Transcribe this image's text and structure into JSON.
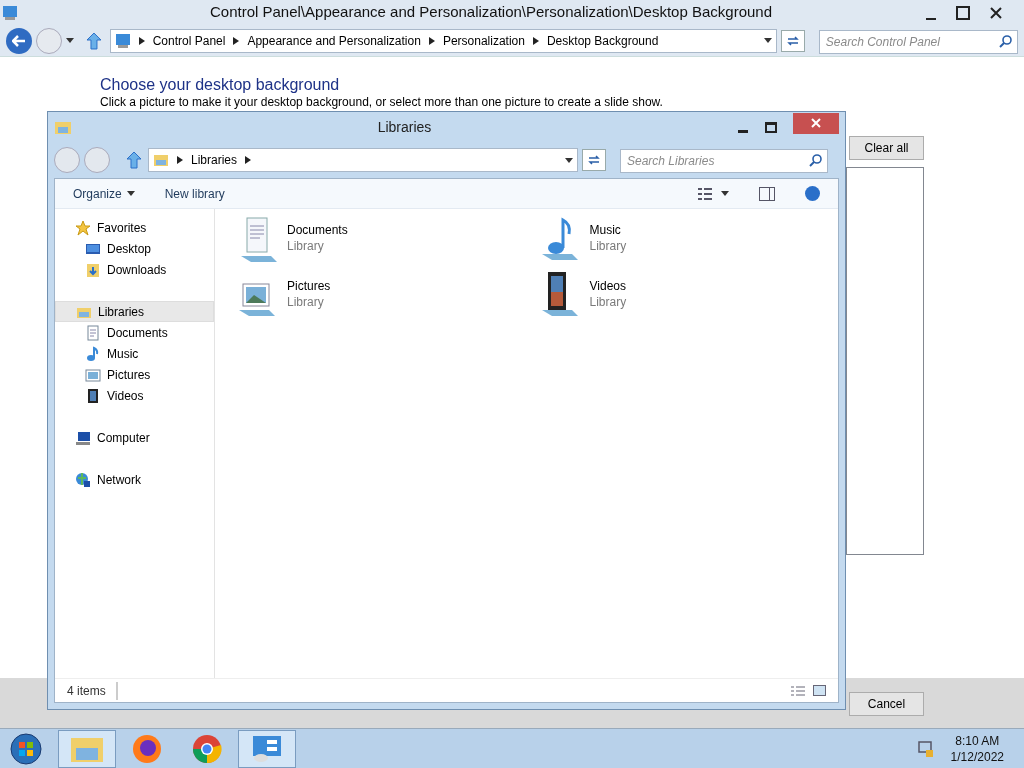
{
  "cp_window": {
    "title": "Control Panel\\Appearance and Personalization\\Personalization\\Desktop Background",
    "breadcrumb": [
      "Control Panel",
      "Appearance and Personalization",
      "Personalization",
      "Desktop Background"
    ],
    "search": {
      "placeholder": "Search Control Panel"
    },
    "heading": "Choose your desktop background",
    "description": "Click a picture to make it your desktop background, or select more than one picture to create a slide show.",
    "buttons": [
      {
        "label": "Clear all"
      },
      {
        "label": "Cancel"
      }
    ]
  },
  "libraries_window": {
    "title": "Libraries",
    "breadcrumb": [
      "Libraries"
    ],
    "search": {
      "placeholder": "Search Libraries"
    },
    "toolbar": [
      {
        "label": "Organize",
        "dropdown": true
      },
      {
        "label": "New library",
        "dropdown": false
      }
    ],
    "nav": [
      {
        "label": "Favorites",
        "kind": "star",
        "selected": false,
        "children": [
          {
            "label": "Desktop",
            "kind": "desktop",
            "selected": false
          },
          {
            "label": "Downloads",
            "kind": "downloads",
            "selected": false
          }
        ]
      },
      {
        "label": "Libraries",
        "kind": "libraries",
        "selected": true,
        "children": [
          {
            "label": "Documents",
            "kind": "documents",
            "selected": false
          },
          {
            "label": "Music",
            "kind": "music",
            "selected": false
          },
          {
            "label": "Pictures",
            "kind": "pictures",
            "selected": false
          },
          {
            "label": "Videos",
            "kind": "videos",
            "selected": false
          }
        ]
      },
      {
        "label": "Computer",
        "kind": "computer",
        "selected": false
      },
      {
        "label": "Network",
        "kind": "network",
        "selected": false
      }
    ],
    "items": [
      {
        "name": "Documents",
        "type": "Library",
        "kind": "documents"
      },
      {
        "name": "Music",
        "type": "Library",
        "kind": "music"
      },
      {
        "name": "Pictures",
        "type": "Library",
        "kind": "pictures"
      },
      {
        "name": "Videos",
        "type": "Library",
        "kind": "videos"
      }
    ],
    "status": "4 items"
  },
  "taskbar": {
    "apps": [
      {
        "kind": "explorer",
        "selected": true
      },
      {
        "kind": "firefox",
        "selected": false
      },
      {
        "kind": "chrome",
        "selected": false
      },
      {
        "kind": "controlpanel",
        "selected": true
      }
    ],
    "time": "8:10 AM",
    "date": "1/12/2022"
  }
}
